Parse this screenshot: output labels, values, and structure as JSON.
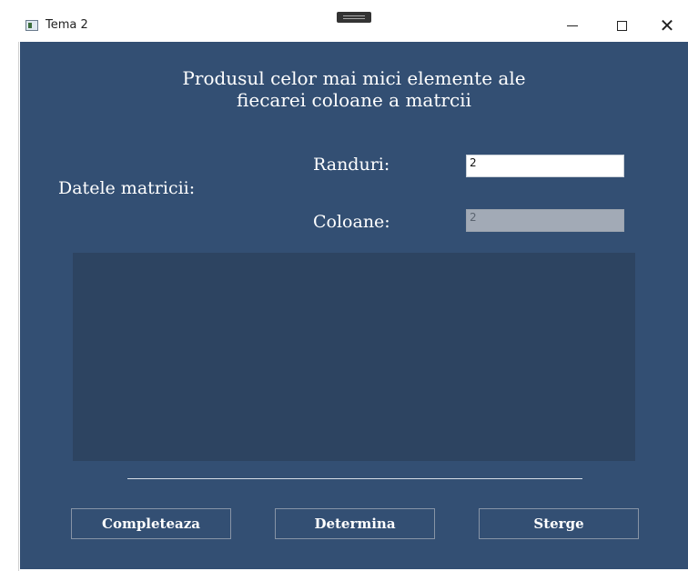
{
  "window": {
    "title": "Tema 2",
    "minimize_glyph": "—",
    "close_glyph": "✕"
  },
  "form": {
    "heading_line1": "Produsul celor mai mici elemente ale",
    "heading_line2": "fiecarei coloane a matrcii",
    "data_label": "Datele matricii:",
    "rows_label": "Randuri:",
    "rows_value": "2",
    "cols_label": "Coloane:",
    "cols_value": "2"
  },
  "buttons": {
    "fill": "Completeaza",
    "determine": "Determina",
    "clear": "Sterge"
  },
  "colors": {
    "client_bg": "#334f73",
    "panel_bg": "#2d4461",
    "disabled_input": "#a2aab6"
  },
  "icons": {
    "app": "app-window-icon",
    "minimize": "minimize-icon",
    "maximize": "maximize-icon",
    "close": "close-icon",
    "drag": "drag-grip-icon"
  }
}
